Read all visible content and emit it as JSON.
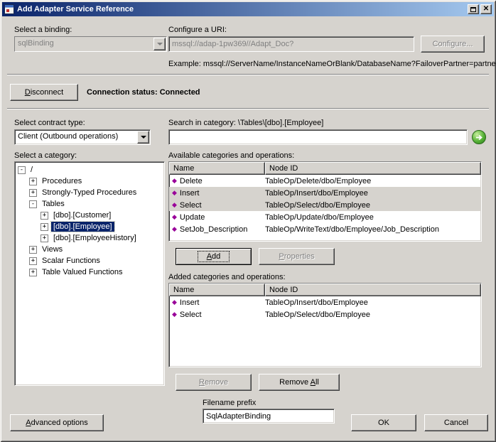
{
  "window": {
    "title": "Add Adapter Service Reference"
  },
  "icons": {
    "close": "✕",
    "operation": "◆",
    "expand": "+",
    "collapse": "-"
  },
  "colors": {
    "titlebar_start": "#0a246a",
    "titlebar_end": "#a6caf0",
    "dialog_face": "#d6d3ce",
    "tree_selection": "#0a246a",
    "operation_icon": "#990099",
    "go_button": "#3f9e2f"
  },
  "binding": {
    "label": "Select a binding:",
    "value": "sqlBinding"
  },
  "uri": {
    "label": "Configure a URI:",
    "value": "mssql://adap-1pw369//Adapt_Doc?",
    "configure": "Configure...",
    "example": "Example: mssql://ServerName/InstanceNameOrBlank/DatabaseName?FailoverPartner=partner"
  },
  "connection": {
    "disconnect": "Disconnect",
    "status_label": "Connection status:",
    "status_value": "Connected"
  },
  "contract": {
    "label": "Select contract type:",
    "value": "Client (Outbound operations)"
  },
  "search": {
    "label": "Search in category: \\Tables\\[dbo].[Employee]",
    "value": ""
  },
  "category": {
    "label": "Select a category:",
    "tree": [
      {
        "label": "/",
        "level": 0,
        "expanded": true
      },
      {
        "label": "Procedures",
        "level": 1
      },
      {
        "label": "Strongly-Typed Procedures",
        "level": 1
      },
      {
        "label": "Tables",
        "level": 1,
        "expanded": true
      },
      {
        "label": "[dbo].[Customer]",
        "level": 2
      },
      {
        "label": "[dbo].[Employee]",
        "level": 2,
        "selected": true
      },
      {
        "label": "[dbo].[EmployeeHistory]",
        "level": 2
      },
      {
        "label": "Views",
        "level": 1
      },
      {
        "label": "Scalar Functions",
        "level": 1
      },
      {
        "label": "Table Valued Functions",
        "level": 1
      }
    ]
  },
  "available": {
    "label": "Available categories and operations:",
    "columns": [
      "Name",
      "Node ID"
    ],
    "rows": [
      {
        "name": "Delete",
        "node_id": "TableOp/Delete/dbo/Employee"
      },
      {
        "name": "Insert",
        "node_id": "TableOp/Insert/dbo/Employee",
        "selected": true
      },
      {
        "name": "Select",
        "node_id": "TableOp/Select/dbo/Employee",
        "selected": true
      },
      {
        "name": "Update",
        "node_id": "TableOp/Update/dbo/Employee"
      },
      {
        "name": "SetJob_Description",
        "node_id": "TableOp/WriteText/dbo/Employee/Job_Description"
      }
    ]
  },
  "actions": {
    "add": "Add",
    "properties": "Properties",
    "remove": "Remove",
    "remove_all": "Remove All"
  },
  "added": {
    "label": "Added categories and operations:",
    "columns": [
      "Name",
      "Node ID"
    ],
    "rows": [
      {
        "name": "Insert",
        "node_id": "TableOp/Insert/dbo/Employee"
      },
      {
        "name": "Select",
        "node_id": "TableOp/Select/dbo/Employee"
      }
    ]
  },
  "footer": {
    "advanced": "Advanced options",
    "filename_label": "Filename prefix",
    "filename_value": "SqlAdapterBinding",
    "ok": "OK",
    "cancel": "Cancel"
  }
}
